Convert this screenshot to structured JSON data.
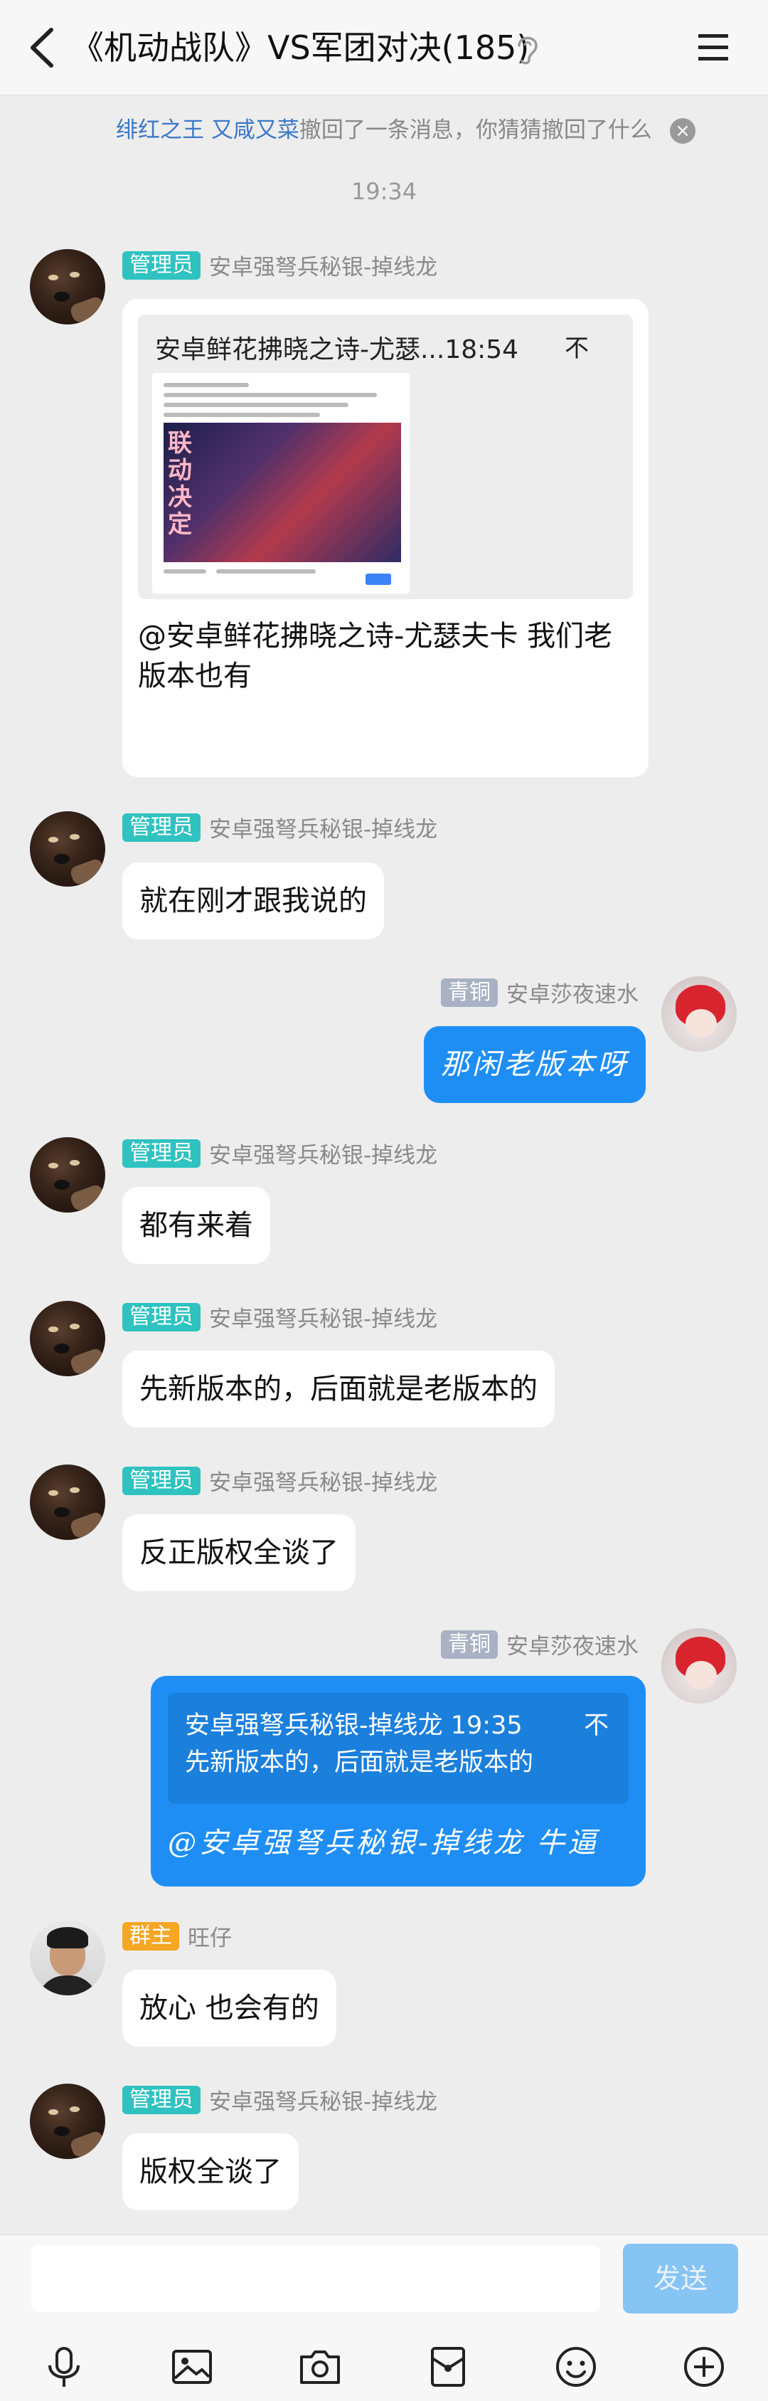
{
  "header": {
    "title": "《机动战队》VS军团对决(185)"
  },
  "notice": {
    "user1": "绯红之王",
    "user2": "又咸又菜",
    "text": "撤回了一条消息，你猜猜撤回了什么"
  },
  "time": "19:34",
  "messages": {
    "m1": {
      "badge": "管理员",
      "sender": "安卓强弩兵秘银-掉线龙",
      "card_title": "安卓鲜花拂晓之诗-尤瑟...18:54",
      "card_pin": "不",
      "poster_text": "联动决定",
      "text": "@安卓鲜花拂晓之诗-尤瑟夫卡 我们老版本也有"
    },
    "m2": {
      "badge": "管理员",
      "sender": "安卓强弩兵秘银-掉线龙",
      "text": "就在刚才跟我说的"
    },
    "m3": {
      "badge": "青铜",
      "sender": "安卓莎夜速水",
      "text": "那闲老版本呀"
    },
    "m4": {
      "badge": "管理员",
      "sender": "安卓强弩兵秘银-掉线龙",
      "text": "都有来着"
    },
    "m5": {
      "badge": "管理员",
      "sender": "安卓强弩兵秘银-掉线龙",
      "text": "先新版本的，后面就是老版本的"
    },
    "m6": {
      "badge": "管理员",
      "sender": "安卓强弩兵秘银-掉线龙",
      "text": "反正版权全谈了"
    },
    "m7": {
      "badge": "青铜",
      "sender": "安卓莎夜速水",
      "quote_header": "安卓强弩兵秘银-掉线龙 19:35",
      "quote_pin": "不",
      "quote_text": "先新版本的，后面就是老版本的",
      "text": "@安卓强弩兵秘银-掉线龙 牛逼"
    },
    "m8": {
      "badge": "群主",
      "sender": "旺仔",
      "text": "放心 也会有的"
    },
    "m9": {
      "badge": "管理员",
      "sender": "安卓强弩兵秘银-掉线龙",
      "text": "版权全谈了"
    }
  },
  "input": {
    "send_label": "发送"
  },
  "toolbar": {
    "icons": [
      "microphone-icon",
      "image-icon",
      "camera-icon",
      "red-packet-icon",
      "emoji-icon",
      "plus-icon"
    ]
  },
  "colors": {
    "accent": "#1e8ef5",
    "admin_badge": "#2fc2c0",
    "bronze_badge": "#a9b1c4",
    "owner_badge": "#f5a623",
    "background": "#ededed"
  }
}
